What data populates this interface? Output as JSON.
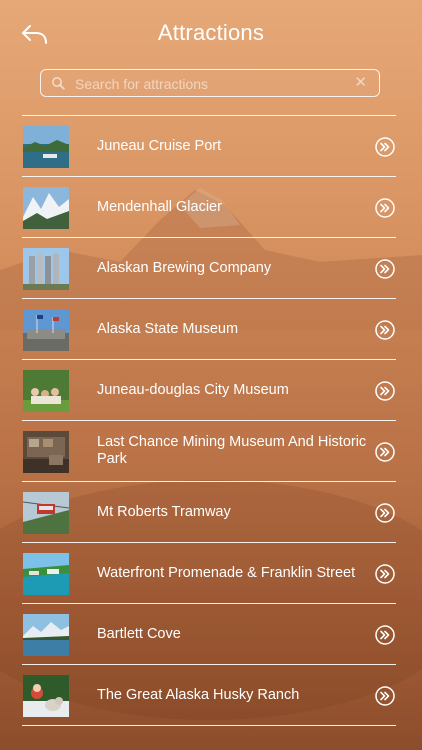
{
  "header": {
    "title": "Attractions",
    "back_icon": "back-arrow-icon"
  },
  "search": {
    "placeholder": "Search for attractions",
    "value": "",
    "icon": "search-icon",
    "clear_icon": "clear-icon"
  },
  "attractions": [
    {
      "name": "Juneau Cruise Port",
      "thumb": "cruise-port-photo"
    },
    {
      "name": "Mendenhall Glacier",
      "thumb": "glacier-photo"
    },
    {
      "name": "Alaskan Brewing Company",
      "thumb": "brewing-photo"
    },
    {
      "name": "Alaska State Museum",
      "thumb": "state-museum-photo"
    },
    {
      "name": "Juneau-douglas City Museum",
      "thumb": "city-museum-photo"
    },
    {
      "name": "Last Chance Mining Museum And Historic Park",
      "thumb": "mining-museum-photo"
    },
    {
      "name": "Mt Roberts Tramway",
      "thumb": "tramway-photo"
    },
    {
      "name": "Waterfront Promenade & Franklin Street",
      "thumb": "waterfront-photo"
    },
    {
      "name": "Bartlett Cove",
      "thumb": "bartlett-cove-photo"
    },
    {
      "name": "The Great Alaska Husky Ranch",
      "thumb": "husky-ranch-photo"
    }
  ],
  "colors": {
    "background_top": "#e6a877",
    "background_bottom": "#8f4f2e",
    "text": "#ffffff"
  }
}
